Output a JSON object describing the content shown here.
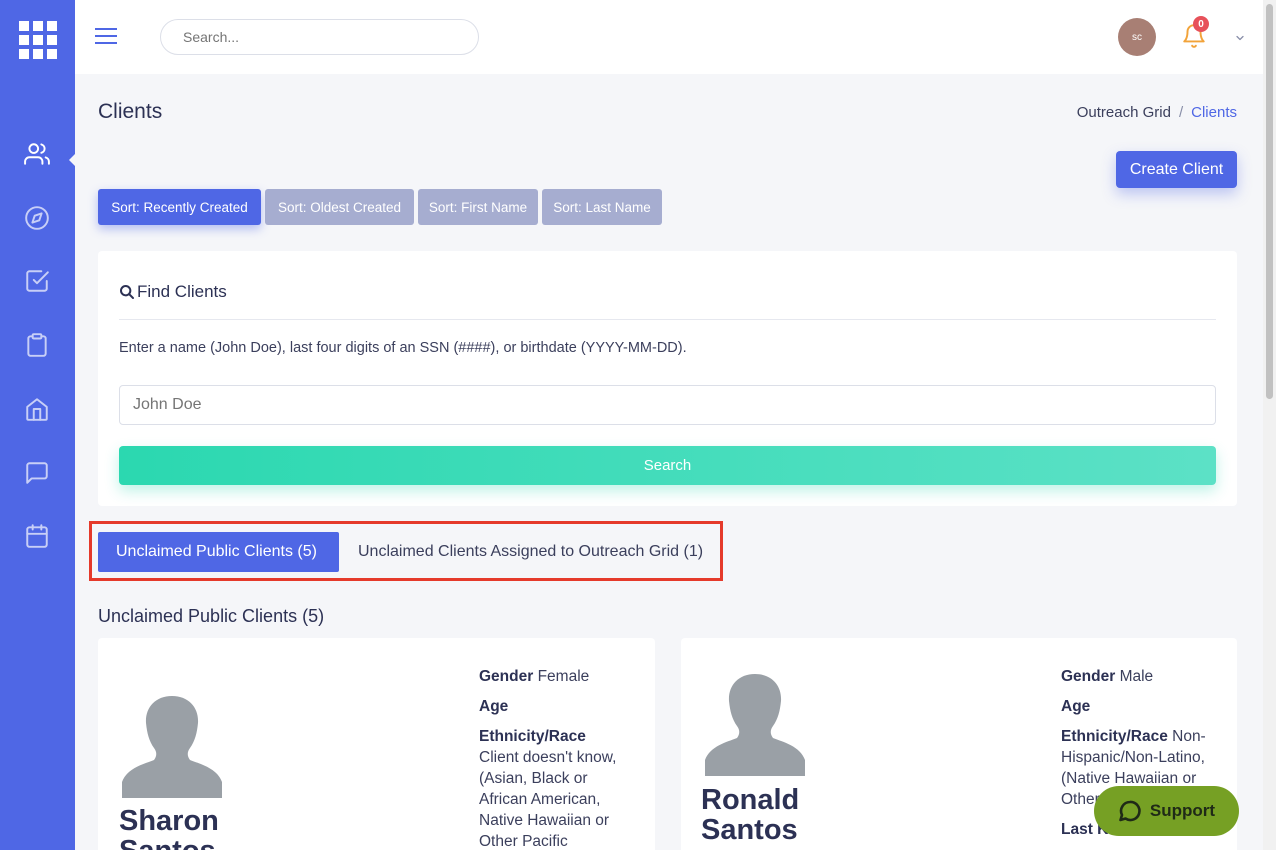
{
  "topbar": {
    "search_placeholder": "Search...",
    "avatar_initials": "sc",
    "notification_count": "0"
  },
  "page": {
    "title": "Clients",
    "breadcrumb": [
      "Outreach Grid",
      "/",
      "Clients"
    ]
  },
  "actions": {
    "create_client": "Create Client"
  },
  "sort_buttons": [
    {
      "label": "Sort: Recently Created",
      "active": true
    },
    {
      "label": "Sort: Oldest Created",
      "active": false
    },
    {
      "label": "Sort: First Name",
      "active": false
    },
    {
      "label": "Sort: Last Name",
      "active": false
    }
  ],
  "find": {
    "title": "Find Clients",
    "hint": "Enter a name (John Doe), last four digits of an SSN (####), or birthdate (YYYY-MM-DD).",
    "placeholder": "John Doe",
    "search_label": "Search"
  },
  "tabs": [
    {
      "label": "Unclaimed Public Clients (5)",
      "active": true
    },
    {
      "label": "Unclaimed Clients Assigned to Outreach Grid (1)",
      "active": false
    }
  ],
  "section_title": "Unclaimed Public Clients (5)",
  "clients": [
    {
      "first_name": "Sharon",
      "last_name": "Santos",
      "gender_label": "Gender",
      "gender": "Female",
      "age_label": "Age",
      "ethnicity_label": "Ethnicity/Race",
      "ethnicity": "Client doesn't know, (Asian, Black or African American, Native Hawaiian or Other Pacific"
    },
    {
      "first_name": "Ronald",
      "last_name": "Santos",
      "gender_label": "Gender",
      "gender": "Male",
      "age_label": "Age",
      "ethnicity_label": "Ethnicity/Race",
      "ethnicity": "Non-Hispanic/Non-Latino, (Native Hawaiian or Other Pacific Islander)",
      "location_label": "Last Known Location"
    }
  ],
  "support": {
    "label": "Support"
  },
  "colors": {
    "brand": "#4f67e5",
    "accent_green": "#2bd8b0",
    "highlight_frame": "#e53a2b",
    "support": "#76a024"
  }
}
